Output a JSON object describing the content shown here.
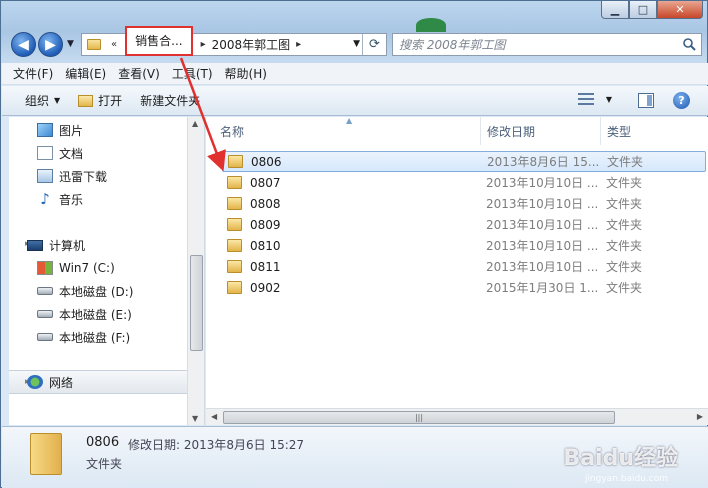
{
  "navigation": {
    "address_crumbs": [
      "销售合...",
      "2008年郭工图"
    ],
    "search_placeholder": "搜索 2008年郭工图"
  },
  "menu": [
    "文件(F)",
    "编辑(E)",
    "查看(V)",
    "工具(T)",
    "帮助(H)"
  ],
  "commands": {
    "organize": "组织",
    "open": "打开",
    "new_folder": "新建文件夹"
  },
  "nav_pane": {
    "favorites": [
      "图片",
      "文档",
      "迅雷下载",
      "音乐"
    ],
    "computer": "计算机",
    "drives": [
      "Win7 (C:)",
      "本地磁盘 (D:)",
      "本地磁盘 (E:)",
      "本地磁盘 (F:)"
    ],
    "network": "网络"
  },
  "columns": {
    "name": "名称",
    "date": "修改日期",
    "type": "类型"
  },
  "files": [
    {
      "name": "0806",
      "date": "2013年8月6日 15...",
      "type": "文件夹"
    },
    {
      "name": "0807",
      "date": "2013年10月10日 ...",
      "type": "文件夹"
    },
    {
      "name": "0808",
      "date": "2013年10月10日 ...",
      "type": "文件夹"
    },
    {
      "name": "0809",
      "date": "2013年10月10日 ...",
      "type": "文件夹"
    },
    {
      "name": "0810",
      "date": "2013年10月10日 ...",
      "type": "文件夹"
    },
    {
      "name": "0811",
      "date": "2013年10月10日 ...",
      "type": "文件夹"
    },
    {
      "name": "0902",
      "date": "2015年1月30日 1...",
      "type": "文件夹"
    }
  ],
  "details": {
    "name": "0806",
    "meta": "修改日期: 2013年8月6日 15:27",
    "type": "文件夹"
  },
  "watermark": {
    "logo": "Baidu经验",
    "url": "jingyan.baidu.com"
  },
  "colors": {
    "highlight": "#e0312f",
    "selection": "#d6e8fb"
  }
}
